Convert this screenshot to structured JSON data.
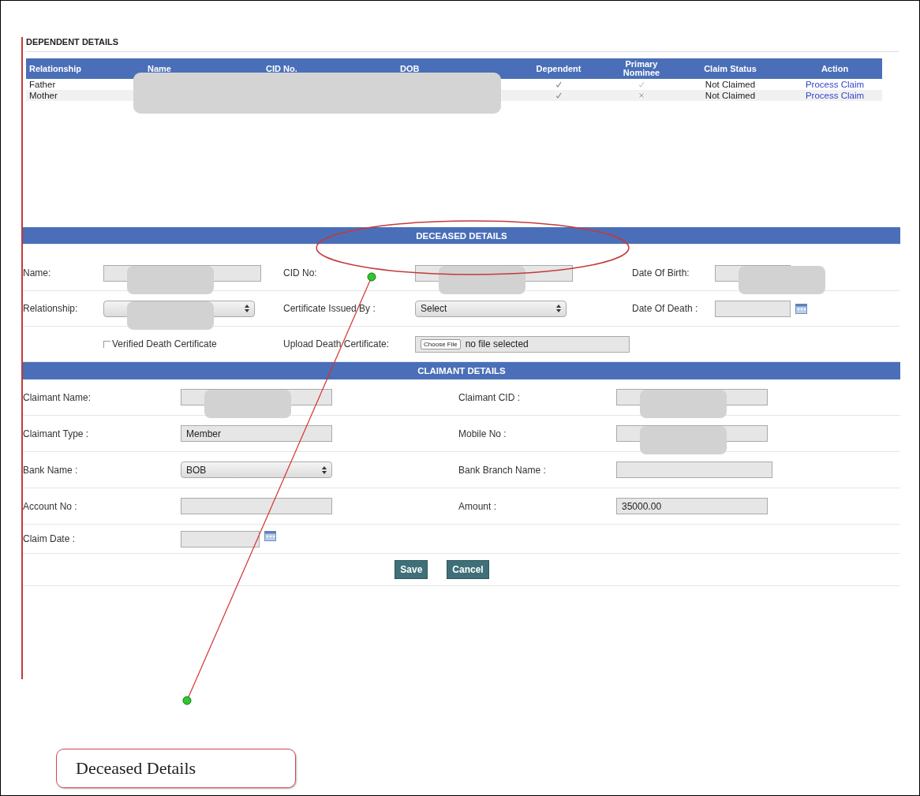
{
  "dependents": {
    "title": "DEPENDENT DETAILS",
    "columns": [
      "Relationship",
      "Name",
      "CID No.",
      "DOB",
      "Dependent",
      "Primary Nominee",
      "Claim Status",
      "Action"
    ],
    "rows": [
      {
        "relationship": "Father",
        "dependent": true,
        "primary_nominee": true,
        "status": "Not Claimed",
        "action": "Process Claim"
      },
      {
        "relationship": "Mother",
        "dependent": true,
        "primary_nominee": false,
        "status": "Not Claimed",
        "action": "Process Claim"
      }
    ],
    "redacted": true
  },
  "deceased": {
    "title": "DECEASED DETAILS",
    "rows": [
      [
        {
          "label": "Name:",
          "kind": "text",
          "redacted": true
        },
        {
          "label": "CID No:",
          "kind": "text",
          "redacted": true
        },
        {
          "label": "Date Of Birth:",
          "kind": "text",
          "redacted": true
        }
      ],
      [
        {
          "label": "Relationship:",
          "kind": "select",
          "redacted": true
        },
        {
          "label": "Certificate Issued By :",
          "kind": "select",
          "value": "Select"
        },
        {
          "label": "Date Of Death :",
          "kind": "date"
        }
      ],
      [
        {
          "label": "Verified Death Certificate",
          "kind": "checkbox",
          "checked": false
        },
        {
          "label": "Upload Death Certificate:",
          "kind": "file",
          "button": "Choose File",
          "value": "no file selected"
        }
      ]
    ]
  },
  "claimant": {
    "title": "CLAIMANT DETAILS",
    "rows": [
      [
        {
          "label": "Claimant Name:",
          "kind": "text",
          "redacted": true
        },
        {
          "label": "Claimant CID :",
          "kind": "text",
          "redacted": true
        }
      ],
      [
        {
          "label": "Claimant Type :",
          "kind": "text",
          "value": "Member"
        },
        {
          "label": "Mobile No :",
          "kind": "text",
          "redacted": true
        }
      ],
      [
        {
          "label": "Bank Name :",
          "kind": "select",
          "value": "BOB"
        },
        {
          "label": "Bank Branch Name :",
          "kind": "text"
        }
      ],
      [
        {
          "label": "Account No :",
          "kind": "text"
        },
        {
          "label": "Amount :",
          "kind": "text",
          "value": "35000.00"
        }
      ],
      [
        {
          "label": "Claim Date :",
          "kind": "date"
        }
      ]
    ],
    "buttons": [
      "Save",
      "Cancel"
    ]
  },
  "annotation": {
    "callout": "Deceased Details"
  }
}
